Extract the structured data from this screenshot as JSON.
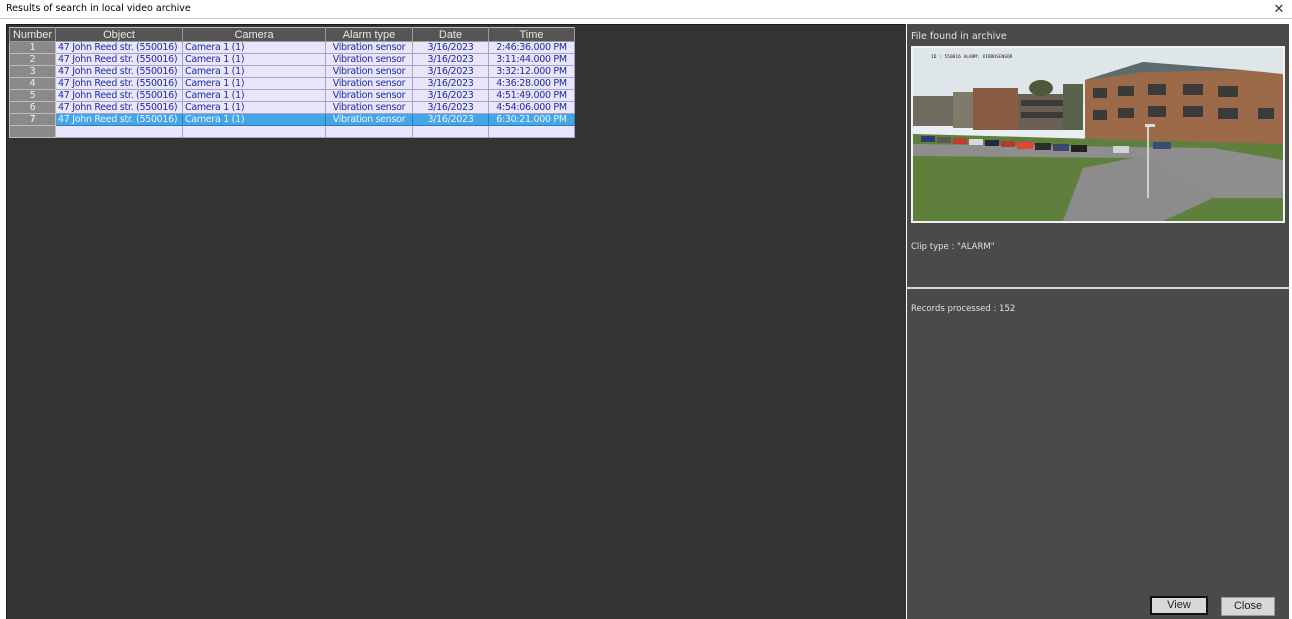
{
  "window": {
    "title": "Results of search in local video archive",
    "close_glyph": "✕"
  },
  "table": {
    "columns": [
      "Number",
      "Object",
      "Camera",
      "Alarm type",
      "Date",
      "Time"
    ],
    "rows": [
      {
        "number": "1",
        "object": "47 John Reed str. (550016)",
        "camera": "Camera 1 (1)",
        "alarm": "Vibration sensor",
        "date": "3/16/2023",
        "time": "2:46:36.000 PM"
      },
      {
        "number": "2",
        "object": "47 John Reed str. (550016)",
        "camera": "Camera 1 (1)",
        "alarm": "Vibration sensor",
        "date": "3/16/2023",
        "time": "3:11:44.000 PM"
      },
      {
        "number": "3",
        "object": "47 John Reed str. (550016)",
        "camera": "Camera 1 (1)",
        "alarm": "Vibration sensor",
        "date": "3/16/2023",
        "time": "3:32:12.000 PM"
      },
      {
        "number": "4",
        "object": "47 John Reed str. (550016)",
        "camera": "Camera 1 (1)",
        "alarm": "Vibration sensor",
        "date": "3/16/2023",
        "time": "4:36:28.000 PM"
      },
      {
        "number": "5",
        "object": "47 John Reed str. (550016)",
        "camera": "Camera 1 (1)",
        "alarm": "Vibration sensor",
        "date": "3/16/2023",
        "time": "4:51:49.000 PM"
      },
      {
        "number": "6",
        "object": "47 John Reed str. (550016)",
        "camera": "Camera 1 (1)",
        "alarm": "Vibration sensor",
        "date": "3/16/2023",
        "time": "4:54:06.000 PM"
      },
      {
        "number": "7",
        "object": "47 John Reed str. (550016)",
        "camera": "Camera 1 (1)",
        "alarm": "Vibration sensor",
        "date": "3/16/2023",
        "time": "6:30:21.000 PM"
      }
    ],
    "selected_row": "7"
  },
  "side": {
    "header": "File found in archive",
    "clip_type": "Clip type : \"ALARM\"",
    "records": "Records processed : 152",
    "overlay_text": "ID : 550016   ALARM: VIBROSENSOR",
    "view_label": "View",
    "close_label": "Close"
  },
  "colors": {
    "row_bg": "#e9e5fa",
    "row_text": "#1c2fa0",
    "selected_bg": "#44a6e6",
    "panel_bg": "#333333",
    "side_bg": "#4a4a4a"
  }
}
